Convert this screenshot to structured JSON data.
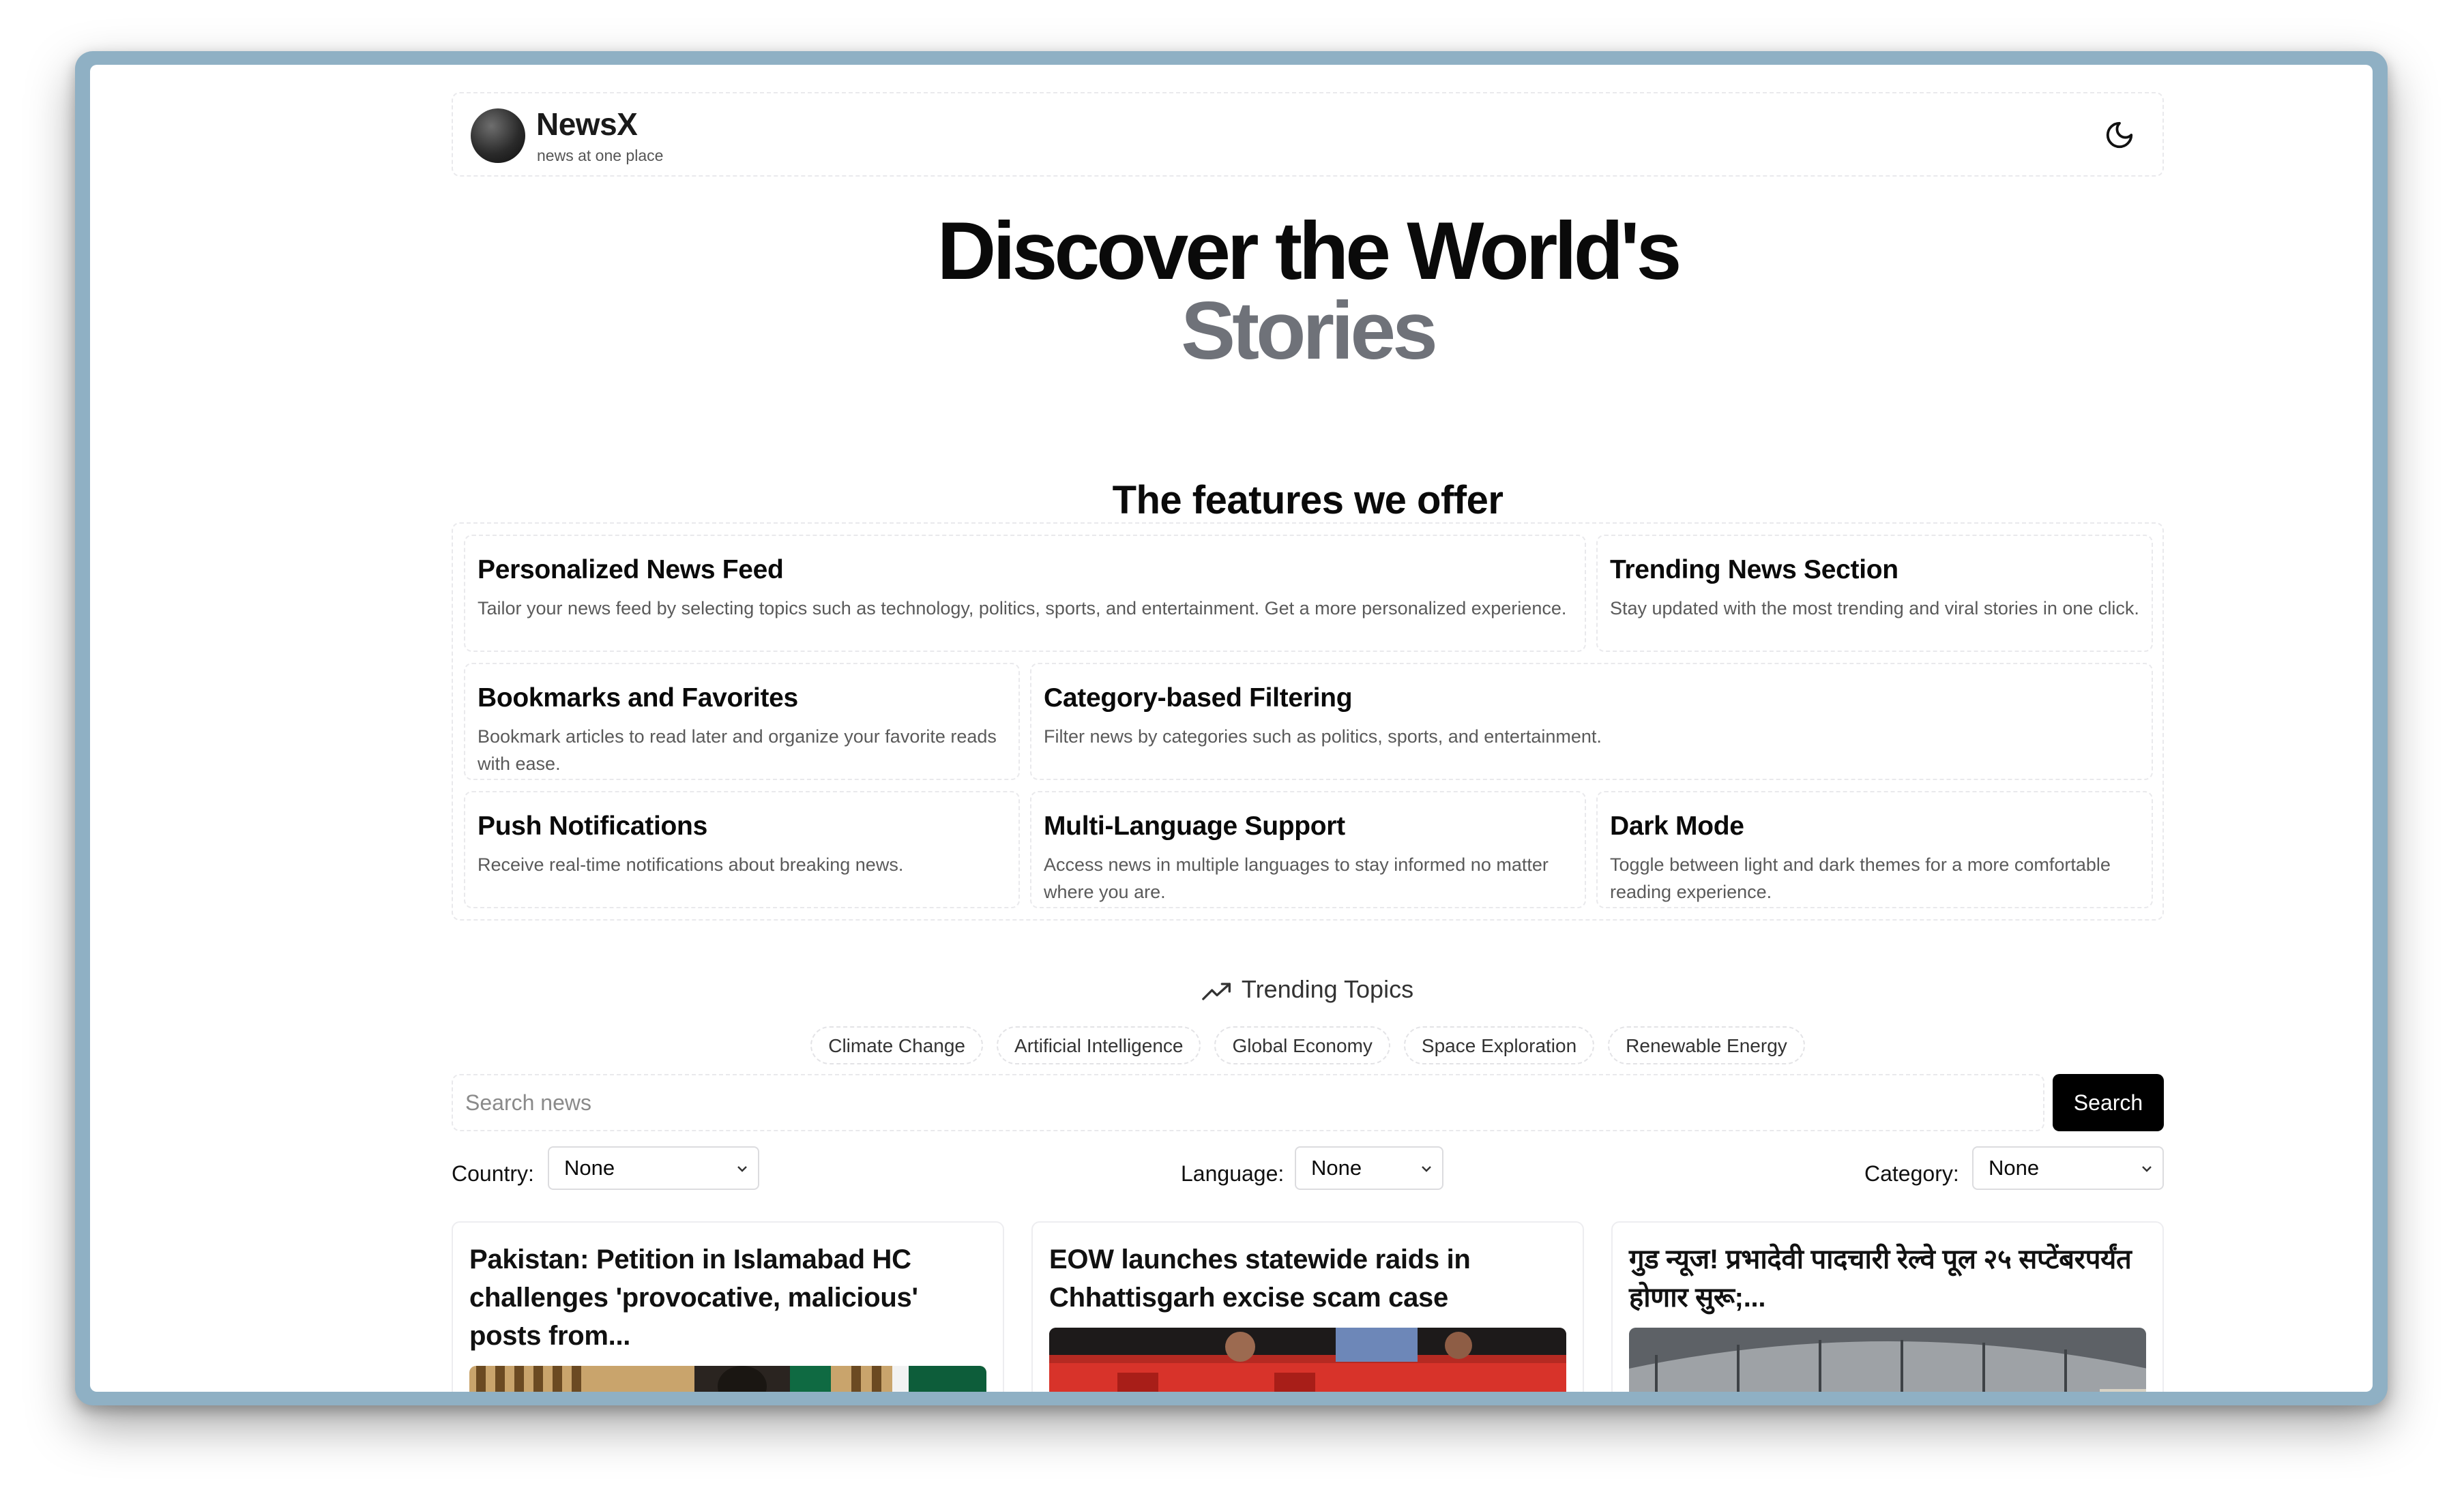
{
  "brand": {
    "name": "NewsX",
    "tagline": "news at one place"
  },
  "header": {
    "theme_toggle_icon": "moon-icon"
  },
  "hero": {
    "line1": "Discover the World's",
    "line2": "Stories"
  },
  "features": {
    "title": "The features we offer",
    "items": [
      {
        "title": "Personalized News Feed",
        "desc": "Tailor your news feed by selecting topics such as technology, politics, sports, and entertainment. Get a more personalized experience."
      },
      {
        "title": "Trending News Section",
        "desc": "Stay updated with the most trending and viral stories in one click."
      },
      {
        "title": "Bookmarks and Favorites",
        "desc": "Bookmark articles to read later and organize your favorite reads with ease."
      },
      {
        "title": "Category-based Filtering",
        "desc": "Filter news by categories such as politics, sports, and entertainment."
      },
      {
        "title": "Push Notifications",
        "desc": "Receive real-time notifications about breaking news."
      },
      {
        "title": "Multi-Language Support",
        "desc": "Access news in multiple languages to stay informed no matter where you are."
      },
      {
        "title": "Dark Mode",
        "desc": "Toggle between light and dark themes for a more comfortable reading experience."
      }
    ]
  },
  "trending": {
    "title": "Trending Topics",
    "icon": "trending-up-icon",
    "topics": [
      "Climate Change",
      "Artificial Intelligence",
      "Global Economy",
      "Space Exploration",
      "Renewable Energy"
    ]
  },
  "search": {
    "placeholder": "Search news",
    "button_label": "Search"
  },
  "filters": {
    "country": {
      "label": "Country:",
      "value": "None"
    },
    "language": {
      "label": "Language:",
      "value": "None"
    },
    "category": {
      "label": "Category:",
      "value": "None"
    }
  },
  "articles": [
    {
      "title": "Pakistan: Petition in Islamabad HC challenges 'provocative, malicious' posts from..."
    },
    {
      "title": "EOW launches statewide raids in Chhattisgarh excise scam case"
    },
    {
      "title": "गुड न्यूज! प्रभादेवी पादचारी रेल्वे पूल २५ सप्टेंबरपर्यंत होणार सुरू;..."
    }
  ],
  "colors": {
    "accent": "#000000",
    "muted_heading": "#6f7279",
    "frame": "#8fb0c4"
  }
}
